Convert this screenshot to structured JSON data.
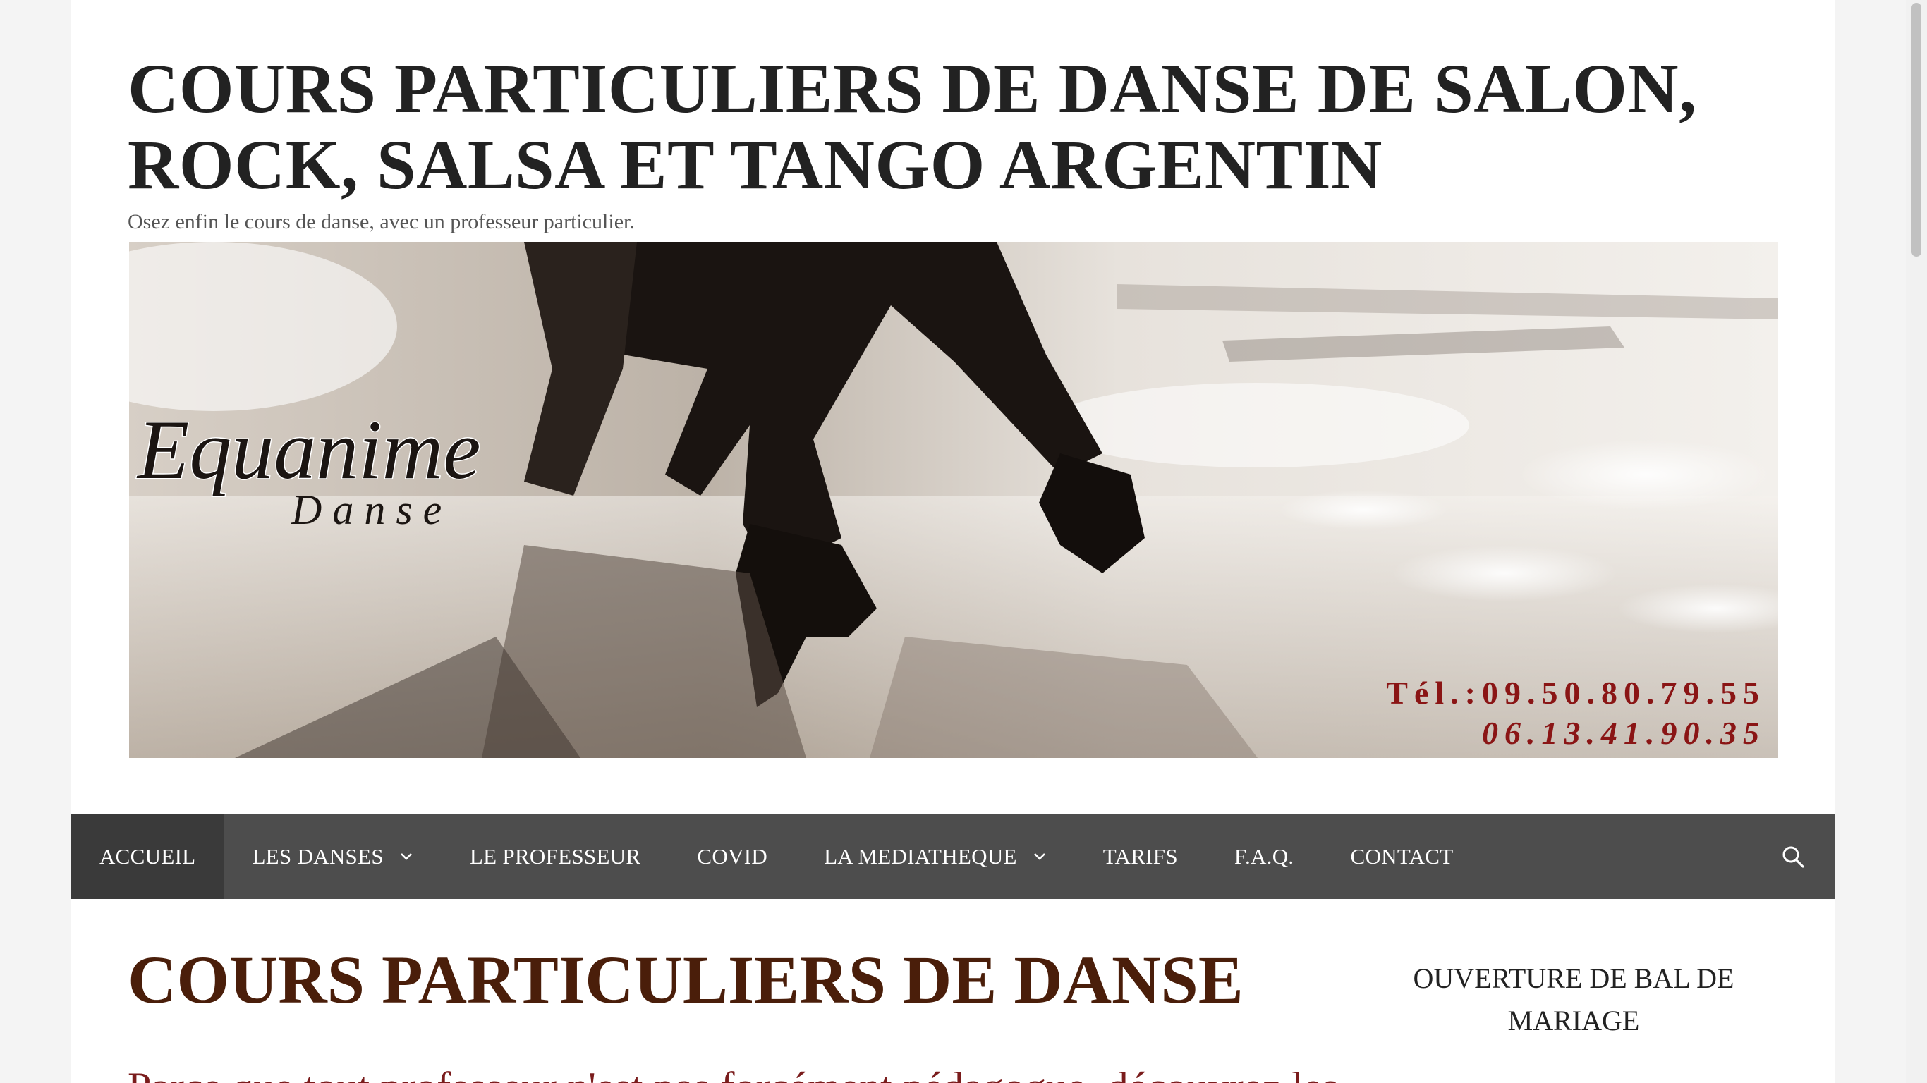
{
  "site": {
    "title": "COURS PARTICULIERS DE DANSE DE SALON, ROCK, SALSA ET TANGO ARGENTIN",
    "tagline": "Osez enfin le cours de danse, avec un professeur particulier."
  },
  "banner": {
    "logo_main": "Equanime",
    "logo_sub": "D a n s e",
    "phone_1": "Tél.:09.50.80.79.55",
    "phone_2": "06.13.41.90.35"
  },
  "nav": {
    "items": [
      {
        "label": "ACCUEIL",
        "active": true
      },
      {
        "label": "LES DANSES",
        "dropdown": true
      },
      {
        "label": "LE PROFESSEUR"
      },
      {
        "label": "COVID"
      },
      {
        "label": "LA MEDIATHEQUE",
        "dropdown": true
      },
      {
        "label": "TARIFS"
      },
      {
        "label": "F.A.Q."
      },
      {
        "label": "CONTACT"
      }
    ],
    "search_icon": "search-icon"
  },
  "main": {
    "title": "COURS PARTICULIERS DE DANSE",
    "subtitle_partial": "Parce que tout professeur n'est pas forcément pédagogue, découvrez les"
  },
  "sidebar": {
    "widget_title": "OUVERTURE DE BAL DE MARIAGE"
  },
  "colors": {
    "nav_bg": "#4d4d4d",
    "nav_active": "#3a3a3a",
    "main_title": "#4a1e0a",
    "phone_text": "#8a1515"
  }
}
